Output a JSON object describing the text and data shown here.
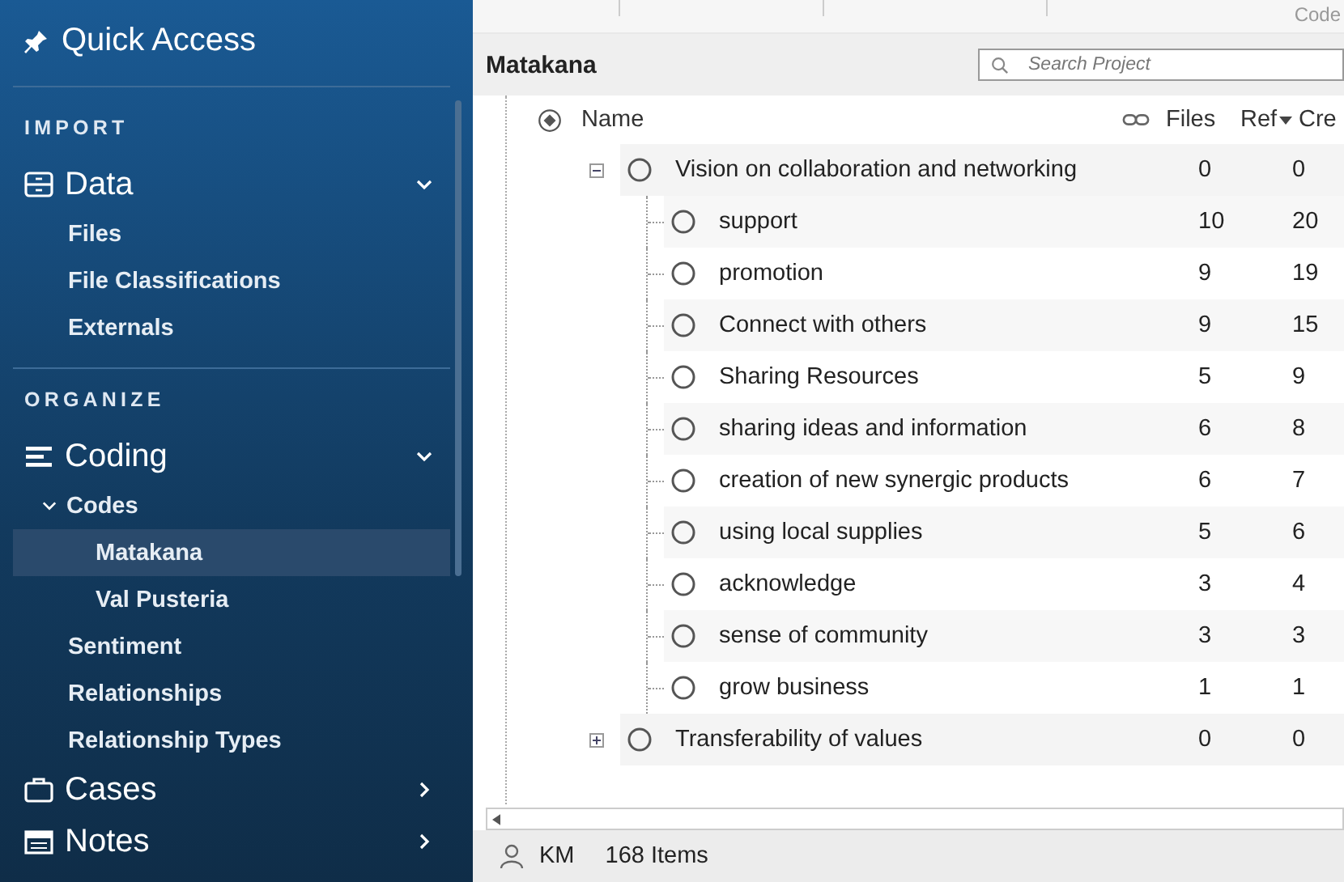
{
  "sidebar": {
    "quick_access": "Quick Access",
    "sections": [
      {
        "label": "IMPORT",
        "groups": [
          {
            "title": "Data",
            "expanded": true,
            "items": [
              {
                "label": "Files",
                "selected": false
              },
              {
                "label": "File Classifications",
                "selected": false
              },
              {
                "label": "Externals",
                "selected": false
              }
            ]
          }
        ]
      },
      {
        "label": "ORGANIZE",
        "groups": [
          {
            "title": "Coding",
            "expanded": true,
            "items": [
              {
                "label": "Codes",
                "selected": false,
                "expanded": true,
                "children": [
                  {
                    "label": "Matakana",
                    "selected": true
                  },
                  {
                    "label": "Val Pusteria",
                    "selected": false
                  }
                ]
              },
              {
                "label": "Sentiment",
                "selected": false
              },
              {
                "label": "Relationships",
                "selected": false
              },
              {
                "label": "Relationship Types",
                "selected": false
              }
            ]
          },
          {
            "title": "Cases",
            "expanded": false
          },
          {
            "title": "Notes",
            "expanded": false
          }
        ]
      }
    ]
  },
  "toolbar": {
    "label": "Code"
  },
  "panel": {
    "title": "Matakana",
    "search": {
      "placeholder": "Search Project"
    },
    "columns": {
      "name": "Name",
      "files": "Files",
      "ref": "Ref",
      "cre": "Cre"
    },
    "rows": [
      {
        "name": "Vision on collaboration and networking",
        "files": "0",
        "ref": "0",
        "expanded": true,
        "children": [
          {
            "name": "support",
            "files": "10",
            "ref": "20"
          },
          {
            "name": "promotion",
            "files": "9",
            "ref": "19"
          },
          {
            "name": "Connect with others",
            "files": "9",
            "ref": "15"
          },
          {
            "name": "Sharing Resources",
            "files": "5",
            "ref": "9"
          },
          {
            "name": "sharing ideas and information",
            "files": "6",
            "ref": "8"
          },
          {
            "name": "creation of new synergic products",
            "files": "6",
            "ref": "7"
          },
          {
            "name": "using local supplies",
            "files": "5",
            "ref": "6"
          },
          {
            "name": "acknowledge",
            "files": "3",
            "ref": "4"
          },
          {
            "name": "sense of community",
            "files": "3",
            "ref": "3"
          },
          {
            "name": "grow business",
            "files": "1",
            "ref": "1"
          }
        ]
      },
      {
        "name": "Transferability of values",
        "files": "0",
        "ref": "0",
        "expanded": false
      }
    ]
  },
  "status_bar": {
    "user": "KM",
    "count": "168 Items"
  }
}
